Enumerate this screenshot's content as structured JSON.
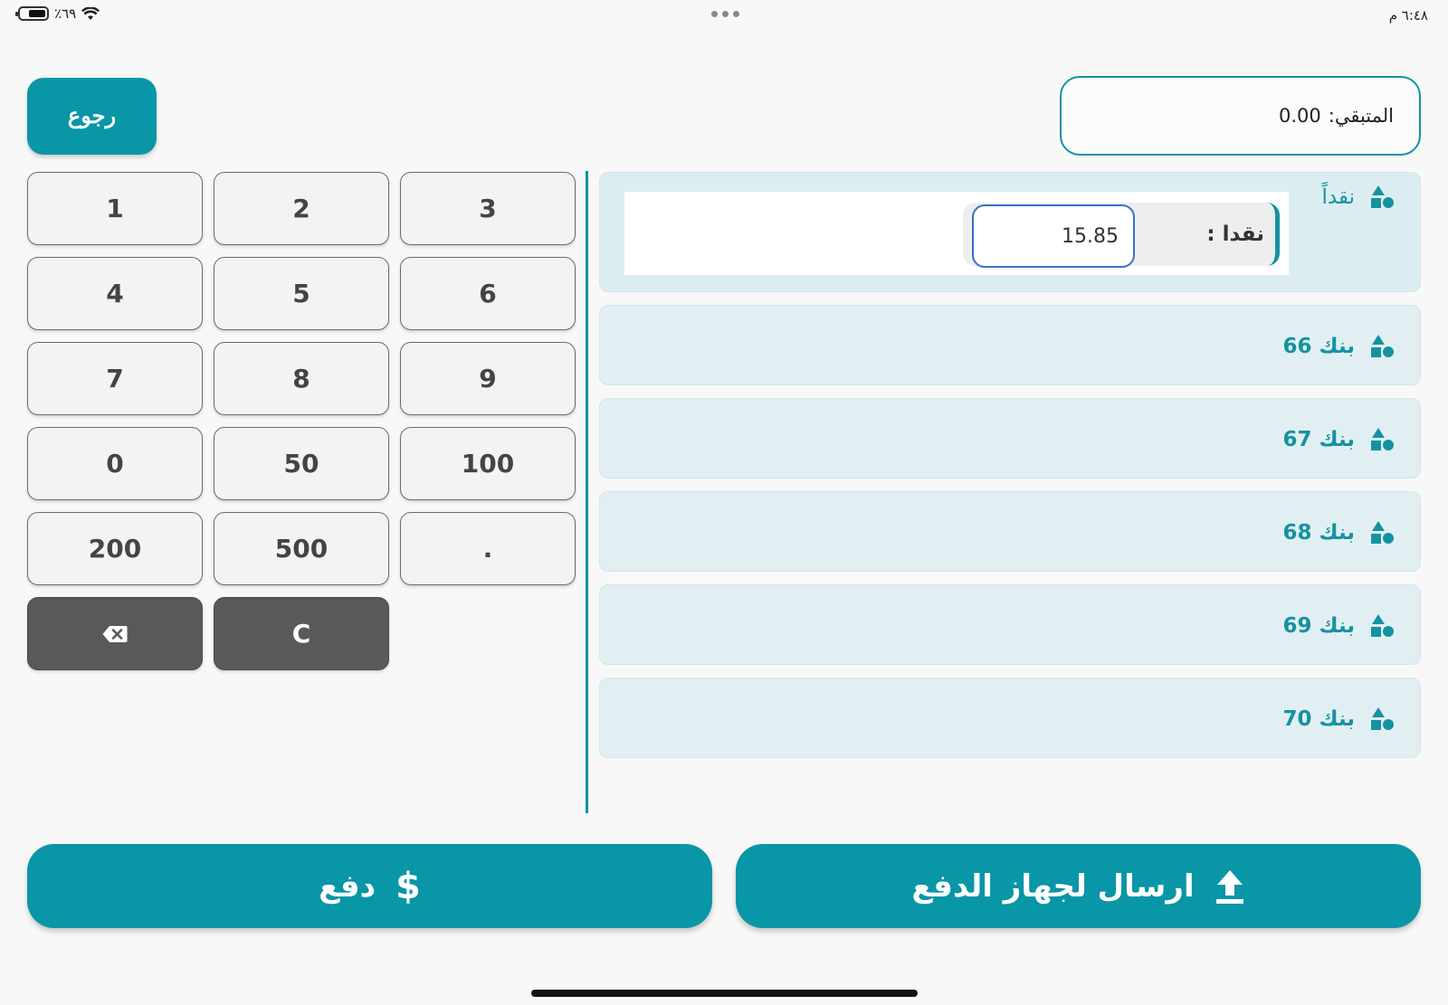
{
  "status_bar": {
    "time": "٦:٤٨ م",
    "battery_percent": "٪٦٩",
    "battery_level": 0.69
  },
  "remaining": {
    "label": "المتبقي:",
    "value": "0.00"
  },
  "back_button": {
    "label": "رجوع"
  },
  "keypad": {
    "keys": [
      "1",
      "2",
      "3",
      "4",
      "5",
      "6",
      "7",
      "8",
      "9",
      "0",
      "50",
      "100",
      "200",
      "500",
      "."
    ],
    "backspace_icon": "backspace-icon",
    "clear_label": "C"
  },
  "payments": {
    "active": {
      "label": "نقداً",
      "field_label": "نقدا :",
      "field_value": "15.85"
    },
    "banks": [
      {
        "label": "بنك 66"
      },
      {
        "label": "بنك 67"
      },
      {
        "label": "بنك 68"
      },
      {
        "label": "بنك 69"
      },
      {
        "label": "بنك 70"
      }
    ],
    "icon": "shapes-icon"
  },
  "actions": {
    "send_label": "ارسال لجهاز الدفع",
    "send_icon": "upload-icon",
    "pay_label": "دفع",
    "pay_icon": "$"
  },
  "colors": {
    "accent": "#0996a6",
    "panel": "#e1eff2",
    "dark_key": "#595959",
    "input_border": "#3b6fc7"
  }
}
